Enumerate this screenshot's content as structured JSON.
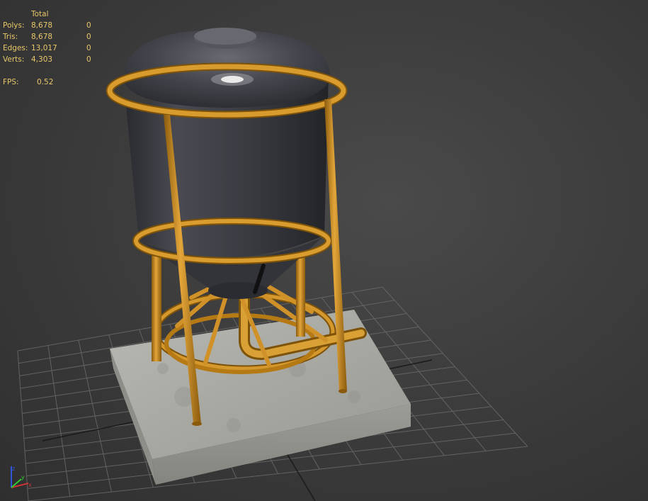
{
  "stats": {
    "header": "Total",
    "rows": [
      {
        "label": "Polys:",
        "total": "8,678",
        "selected": "0"
      },
      {
        "label": "Tris:",
        "total": "8,678",
        "selected": "0"
      },
      {
        "label": "Edges:",
        "total": "13,017",
        "selected": "0"
      },
      {
        "label": "Verts:",
        "total": "4,303",
        "selected": "0"
      }
    ],
    "fps_label": "FPS:",
    "fps_value": "0.52"
  },
  "gizmo": {
    "axis_x_color": "#cc3333",
    "axis_y_color": "#33cc33",
    "axis_z_color": "#3355dd"
  },
  "colors": {
    "stats_text": "#e9c86a",
    "frame_orange": "#c98a1c",
    "tank_dark": "#3c3d44",
    "grid_line": "#6a6a6a"
  }
}
